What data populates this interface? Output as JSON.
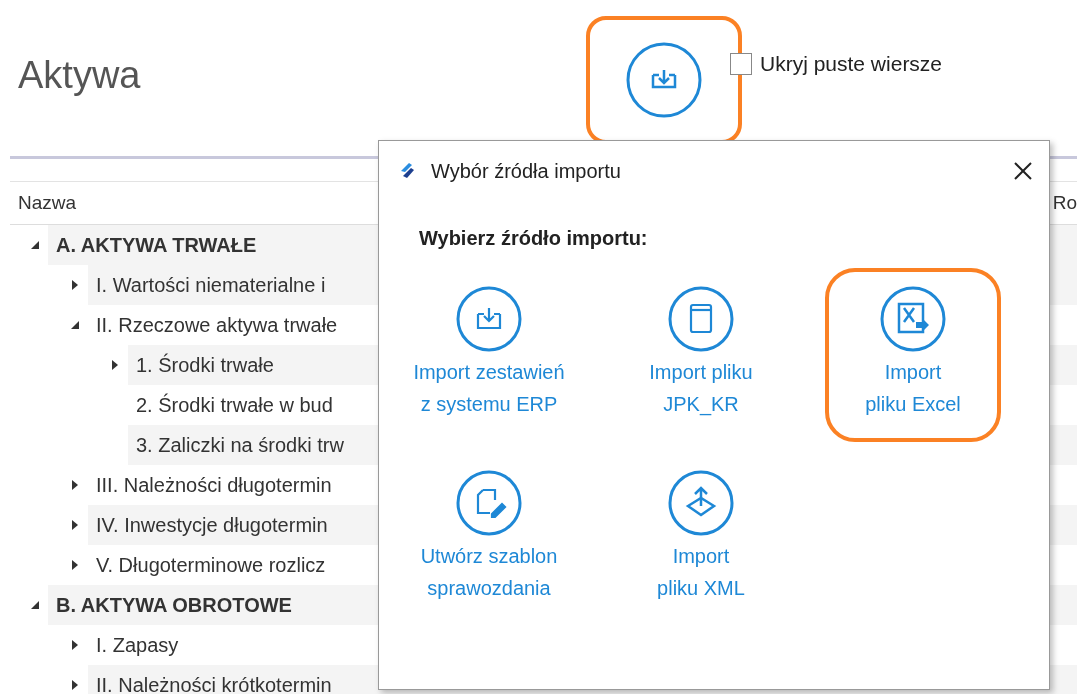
{
  "page": {
    "title": "Aktywa"
  },
  "toolbar": {
    "import_button": {
      "highlighted": true
    },
    "hide_empty_rows": {
      "label": "Ukryj puste wiersze",
      "checked": false
    }
  },
  "table": {
    "columns": [
      "Nazwa",
      "Ro"
    ],
    "rows": [
      {
        "label": "A. AKTYWA TRWAŁE",
        "bold": true,
        "expanded": true,
        "children": [
          {
            "label": "I. Wartości niematerialne i",
            "expanded": false
          },
          {
            "label": "II. Rzeczowe aktywa trwałe",
            "expanded": true,
            "children": [
              {
                "label": "1. Środki trwałe",
                "expanded": false
              },
              {
                "label": "2. Środki trwałe w bud"
              },
              {
                "label": "3. Zaliczki na środki trw"
              }
            ]
          },
          {
            "label": "III. Należności długotermin",
            "expanded": false
          },
          {
            "label": "IV. Inwestycje długotermin",
            "expanded": false
          },
          {
            "label": "V. Długoterminowe rozlicz",
            "expanded": false
          }
        ]
      },
      {
        "label": "B. AKTYWA OBROTOWE",
        "bold": true,
        "expanded": true,
        "children": [
          {
            "label": "I. Zapasy",
            "expanded": false
          },
          {
            "label": "II. Należności krótkotermin",
            "expanded": false
          }
        ]
      }
    ]
  },
  "dialog": {
    "title": "Wybór źródła importu",
    "heading": "Wybierz źródło importu:",
    "options": [
      {
        "kind": "erp",
        "label": "Import zestawień\nz systemu ERP",
        "highlighted": false
      },
      {
        "kind": "jpk",
        "label": "Import pliku\nJPK_KR",
        "highlighted": false
      },
      {
        "kind": "excel",
        "label": "Import\npliku Excel",
        "highlighted": true
      },
      {
        "kind": "template",
        "label": "Utwórz szablon\nsprawozdania",
        "highlighted": false
      },
      {
        "kind": "xml",
        "label": "Import\npliku XML",
        "highlighted": false
      }
    ]
  }
}
